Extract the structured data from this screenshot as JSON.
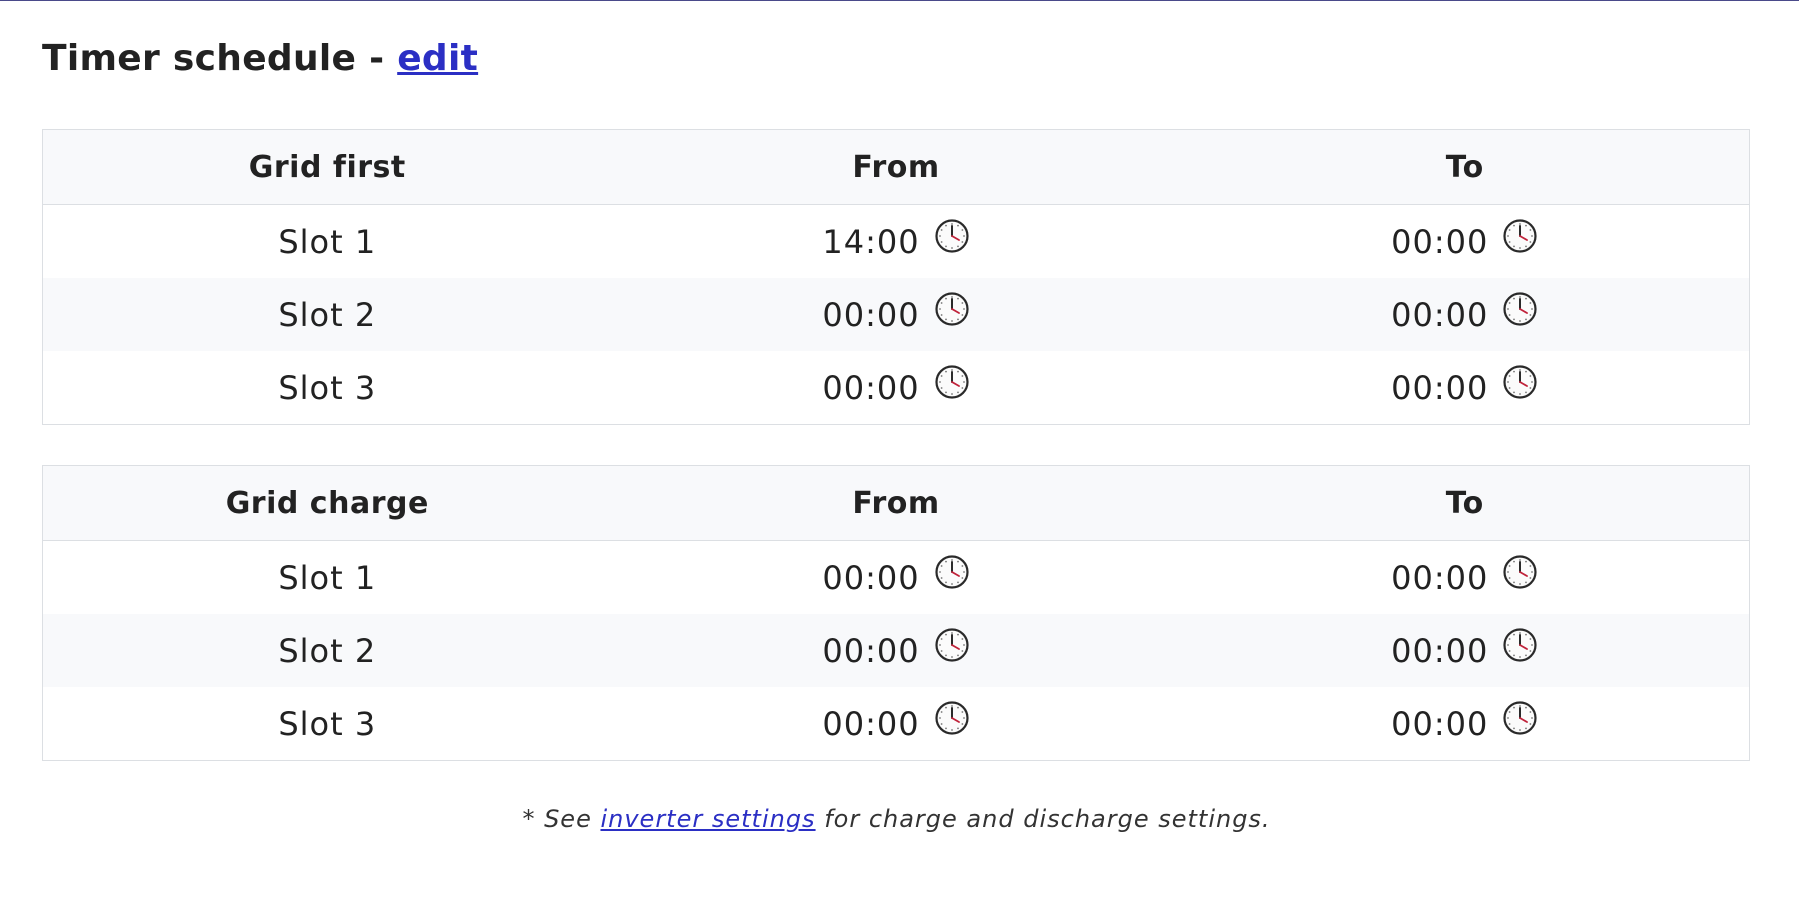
{
  "header": {
    "title": "Timer schedule - ",
    "edit_label": "edit"
  },
  "grid_first": {
    "columns": [
      "Grid first",
      "From",
      "To"
    ],
    "rows": [
      {
        "slot": "Slot 1",
        "from": "14:00",
        "to": "00:00"
      },
      {
        "slot": "Slot 2",
        "from": "00:00",
        "to": "00:00"
      },
      {
        "slot": "Slot 3",
        "from": "00:00",
        "to": "00:00"
      }
    ]
  },
  "grid_charge": {
    "columns": [
      "Grid charge",
      "From",
      "To"
    ],
    "rows": [
      {
        "slot": "Slot 1",
        "from": "00:00",
        "to": "00:00"
      },
      {
        "slot": "Slot 2",
        "from": "00:00",
        "to": "00:00"
      },
      {
        "slot": "Slot 3",
        "from": "00:00",
        "to": "00:00"
      }
    ]
  },
  "footer": {
    "prefix": "* See ",
    "link_label": "inverter settings",
    "suffix": " for charge and discharge settings."
  },
  "icons": {
    "time": "clock-icon"
  },
  "colors": {
    "link": "#2b2fc4",
    "clock_hand": "#c0223a"
  }
}
